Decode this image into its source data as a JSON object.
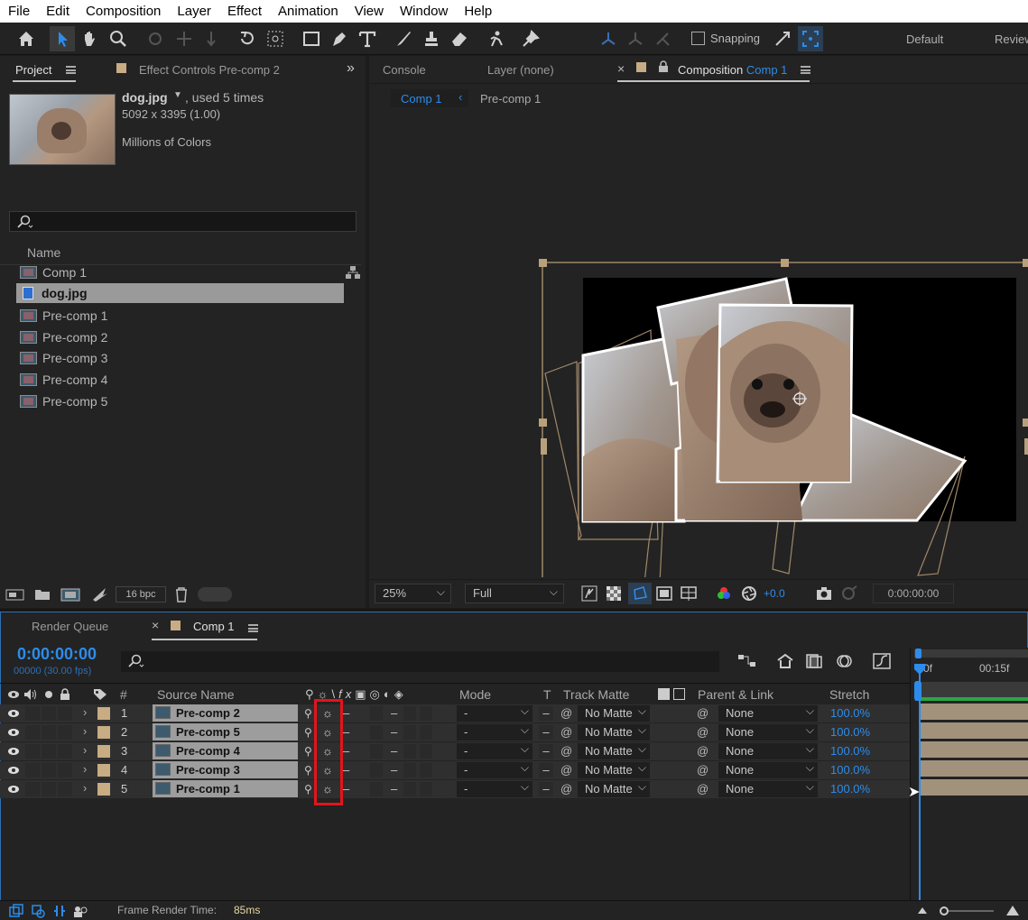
{
  "menu": [
    "File",
    "Edit",
    "Composition",
    "Layer",
    "Effect",
    "Animation",
    "View",
    "Window",
    "Help"
  ],
  "toolbar": {
    "snapping_label": "Snapping",
    "workspace_default": "Default",
    "workspace_review": "Review"
  },
  "project_panel": {
    "tab_project": "Project",
    "tab_effect_controls_prefix": "Effect Controls",
    "tab_effect_controls_target": "Pre-comp 2",
    "selected_name": "dog.jpg",
    "used_times": ", used 5 times",
    "dimensions": "5092 x 3395 (1.00)",
    "colors": "Millions of Colors",
    "search_placeholder": "",
    "name_header": "Name",
    "items": [
      "Comp 1",
      "dog.jpg",
      "Pre-comp 1",
      "Pre-comp 2",
      "Pre-comp 3",
      "Pre-comp 4",
      "Pre-comp 5"
    ],
    "bpc": "16 bpc"
  },
  "viewer_panel": {
    "tab_console": "Console",
    "tab_layer": "Layer (none)",
    "tab_composition_prefix": "Composition",
    "tab_composition_target": "Comp 1",
    "breadcrumb_comp1": "Comp 1",
    "breadcrumb_precomp1": "Pre-comp 1",
    "zoom": "25%",
    "resolution": "Full",
    "exposure": "+0.0",
    "timecode": "0:00:00:00"
  },
  "timeline_panel": {
    "tab_render_queue": "Render Queue",
    "tab_comp": "Comp 1",
    "timecode": "0:00:00:00",
    "frame_info": "00000 (30.00 fps)",
    "ruler_start": "0f",
    "ruler_mark": "00:15f",
    "headers": {
      "hash": "#",
      "source_name": "Source Name",
      "mode": "Mode",
      "t": "T",
      "track_matte": "Track Matte",
      "parent_link": "Parent & Link",
      "stretch": "Stretch"
    },
    "layers": [
      {
        "num": "1",
        "name": "Pre-comp 2",
        "mode": "-",
        "matte": "No Matte",
        "parent": "None",
        "stretch": "100.0%"
      },
      {
        "num": "2",
        "name": "Pre-comp 5",
        "mode": "-",
        "matte": "No Matte",
        "parent": "None",
        "stretch": "100.0%"
      },
      {
        "num": "3",
        "name": "Pre-comp 4",
        "mode": "-",
        "matte": "No Matte",
        "parent": "None",
        "stretch": "100.0%"
      },
      {
        "num": "4",
        "name": "Pre-comp 3",
        "mode": "-",
        "matte": "No Matte",
        "parent": "None",
        "stretch": "100.0%"
      },
      {
        "num": "5",
        "name": "Pre-comp 1",
        "mode": "-",
        "matte": "No Matte",
        "parent": "None",
        "stretch": "100.0%"
      }
    ],
    "frame_render_label": "Frame Render Time:",
    "frame_render_value": "85ms"
  },
  "colors": {
    "accent_blue": "#2d8ceb",
    "label_tan": "#c8ac84",
    "highlight_red": "#e3141c"
  }
}
